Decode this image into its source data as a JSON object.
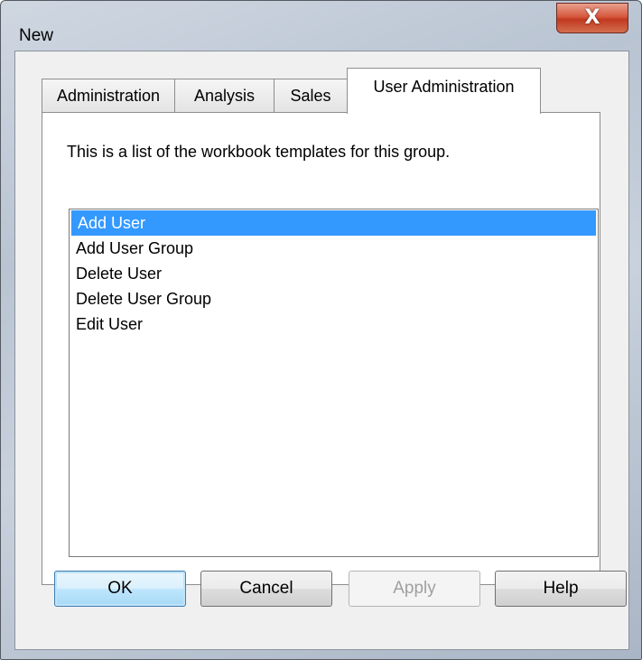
{
  "window": {
    "title": "New",
    "close_glyph": "X"
  },
  "tabs": [
    {
      "label": "Administration",
      "active": false
    },
    {
      "label": "Analysis",
      "active": false
    },
    {
      "label": "Sales",
      "active": false
    },
    {
      "label": "User Administration",
      "active": true
    }
  ],
  "panel": {
    "description": "This is a list of the workbook templates for this group.",
    "templates": [
      {
        "label": "Add User",
        "selected": true
      },
      {
        "label": "Add User Group",
        "selected": false
      },
      {
        "label": "Delete User",
        "selected": false
      },
      {
        "label": "Delete User Group",
        "selected": false
      },
      {
        "label": "Edit User",
        "selected": false
      }
    ]
  },
  "buttons": {
    "ok": "OK",
    "cancel": "Cancel",
    "apply": "Apply",
    "help": "Help"
  },
  "colors": {
    "selection": "#3399ff",
    "close_button": "#c1391f"
  },
  "icons": {
    "close": "close-icon"
  }
}
